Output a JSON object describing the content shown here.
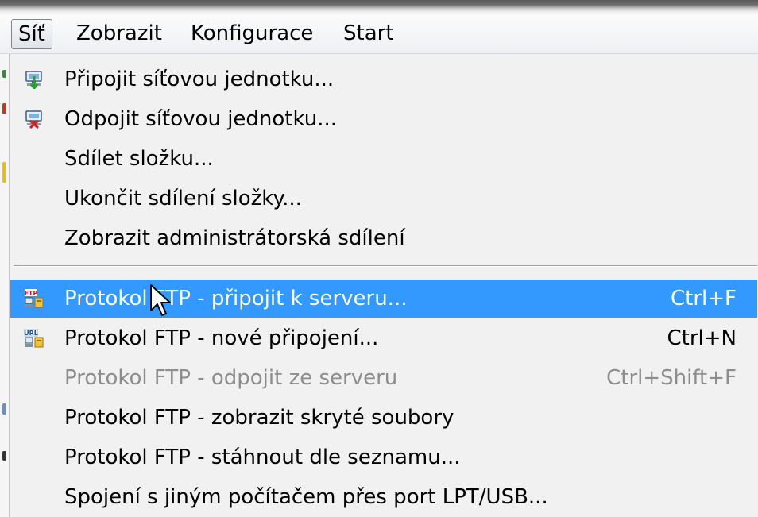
{
  "menubar": {
    "items": [
      {
        "label": "Síť",
        "active": true
      },
      {
        "label": "Zobrazit",
        "active": false
      },
      {
        "label": "Konfigurace",
        "active": false
      },
      {
        "label": "Start",
        "active": false
      }
    ]
  },
  "menu": {
    "items": [
      {
        "label": "Připojit síťovou jednotku...",
        "shortcut": "",
        "icon": "map-network-drive-icon",
        "state": "enabled"
      },
      {
        "label": "Odpojit síťovou jednotku...",
        "shortcut": "",
        "icon": "disconnect-network-drive-icon",
        "state": "enabled"
      },
      {
        "label": "Sdílet složku...",
        "shortcut": "",
        "icon": "",
        "state": "enabled"
      },
      {
        "label": "Ukončit sdílení složky...",
        "shortcut": "",
        "icon": "",
        "state": "enabled"
      },
      {
        "label": "Zobrazit administrátorská sdílení",
        "shortcut": "",
        "icon": "",
        "state": "enabled"
      },
      {
        "label": "Protokol FTP - připojit k serveru...",
        "shortcut": "Ctrl+F",
        "icon": "ftp-connect-icon",
        "icon_text": "FTP",
        "state": "highlighted"
      },
      {
        "label": "Protokol FTP - nové připojení...",
        "shortcut": "Ctrl+N",
        "icon": "ftp-url-icon",
        "icon_text": "URL",
        "state": "enabled"
      },
      {
        "label": "Protokol FTP - odpojit ze serveru",
        "shortcut": "Ctrl+Shift+F",
        "icon": "",
        "state": "disabled"
      },
      {
        "label": "Protokol FTP - zobrazit skryté soubory",
        "shortcut": "",
        "icon": "",
        "state": "enabled"
      },
      {
        "label": "Protokol FTP - stáhnout dle seznamu...",
        "shortcut": "",
        "icon": "",
        "state": "enabled"
      },
      {
        "label": "Spojení s jiným počítačem přes port LPT/USB...",
        "shortcut": "",
        "icon": "",
        "state": "enabled"
      }
    ]
  },
  "colors": {
    "highlight": "#3399ff",
    "menu_background": "#f1f1f1",
    "disabled_text": "#8d8d8d"
  }
}
